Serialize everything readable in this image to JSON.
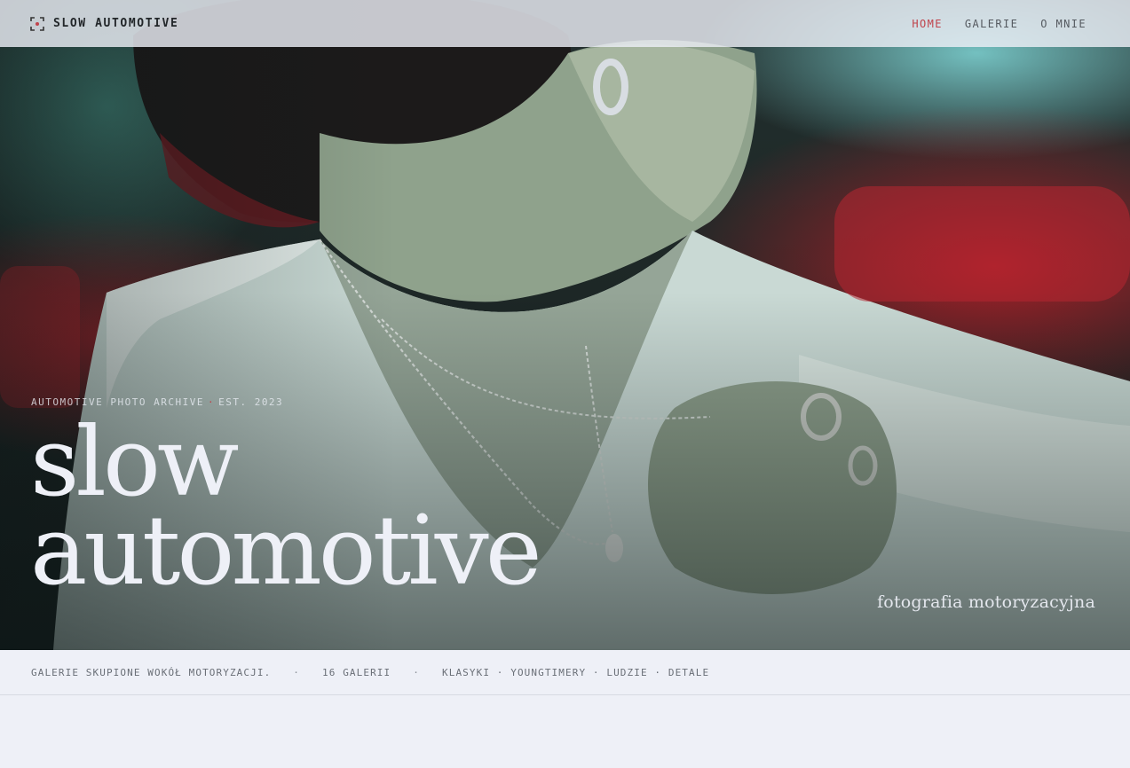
{
  "nav": {
    "brand": "SLOW AUTOMOTIVE",
    "brand_icon": "viewfinder-icon",
    "items": [
      {
        "label": "HOME",
        "active": true
      },
      {
        "label": "GALERIE",
        "active": false
      },
      {
        "label": "O MNIE",
        "active": false
      }
    ]
  },
  "hero": {
    "eyebrow_left": "AUTOMOTIVE PHOTO ARCHIVE",
    "eyebrow_sep": "·",
    "eyebrow_right": "EST. 2023",
    "title_line1": "slow",
    "title_line2": "automotive",
    "tagline": "fotografia motoryzacyjna"
  },
  "infobar": {
    "items": [
      "GALERIE SKUPIONE WOKÓŁ MOTORYZACJI.",
      "16 GALERII",
      "KLASYKI · YOUNGTIMERY · LUDZIE · DETALE"
    ],
    "separator": "·"
  },
  "colors": {
    "accent": "#c0434b",
    "text_light": "#eef0f7",
    "background": "#eef0f7"
  }
}
